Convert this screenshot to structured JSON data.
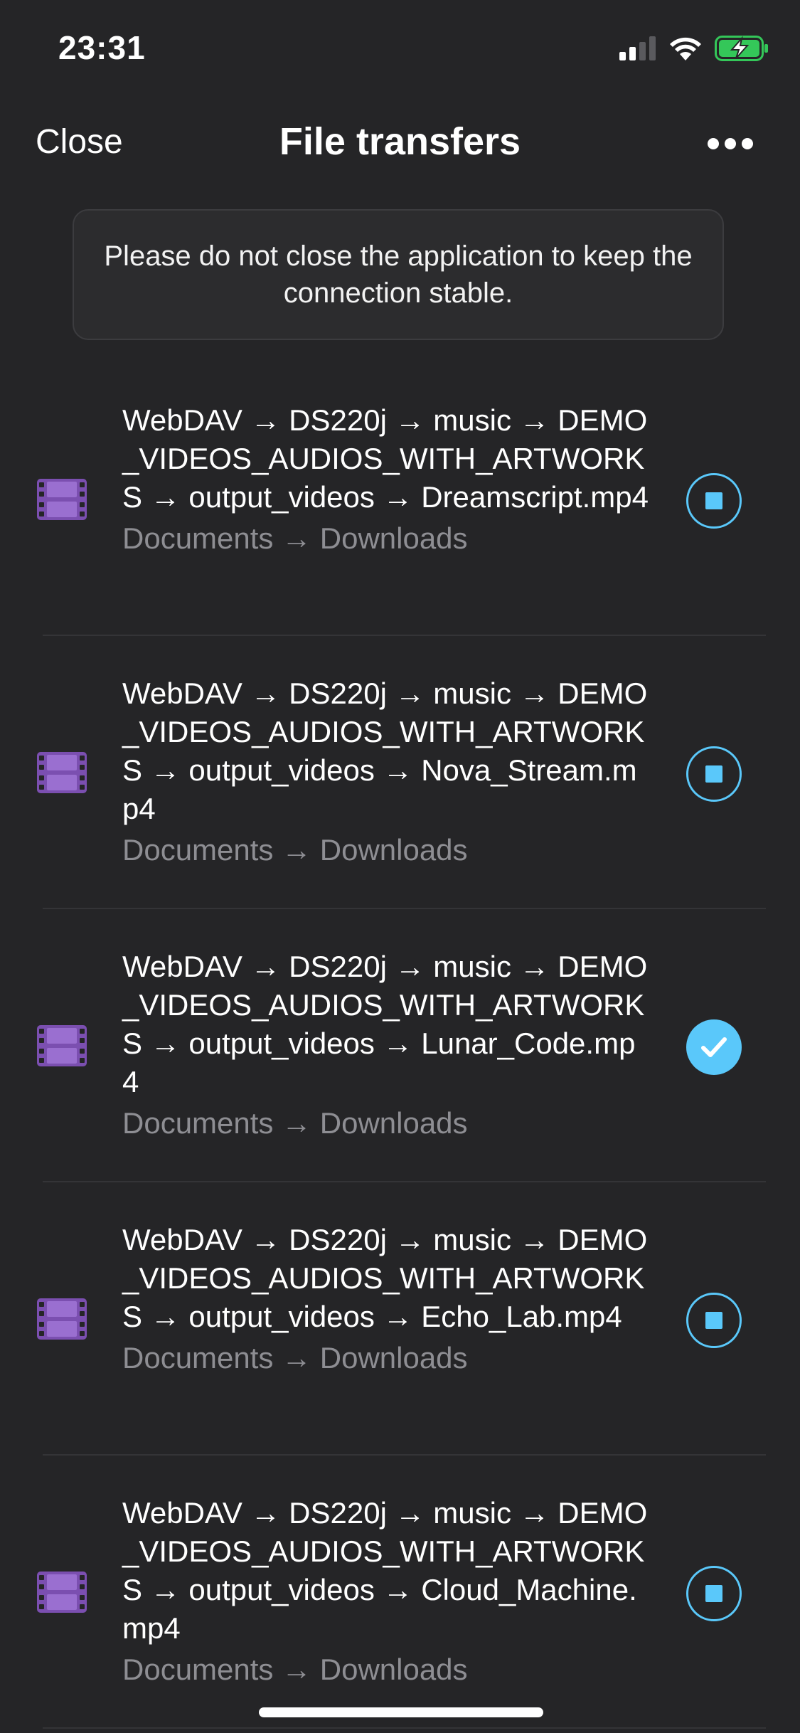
{
  "status_bar": {
    "time": "23:31"
  },
  "nav": {
    "close_label": "Close",
    "title": "File transfers",
    "more_icon": "ellipsis-icon"
  },
  "notice": {
    "text": "Please do not close the application to keep the connection stable."
  },
  "colors": {
    "background": "#252527",
    "accent": "#5ac8fa",
    "file_icon": "#7b4fb0",
    "secondary_text": "#8e8e93",
    "battery_fill": "#34c759"
  },
  "transfers": [
    {
      "path": "WebDAV → DS220j → music → DEMO_VIDEOS_AUDIOS_WITH_ARTWORKS → output_videos → Dreamscript.mp4",
      "destination": "Documents → Downloads",
      "state": "in-progress"
    },
    {
      "path": "WebDAV → DS220j → music → DEMO_VIDEOS_AUDIOS_WITH_ARTWORKS → output_videos → Nova_Stream.mp4",
      "destination": "Documents → Downloads",
      "state": "in-progress"
    },
    {
      "path": "WebDAV → DS220j → music → DEMO_VIDEOS_AUDIOS_WITH_ARTWORKS → output_videos → Lunar_Code.mp4",
      "destination": "Documents → Downloads",
      "state": "completed"
    },
    {
      "path": "WebDAV → DS220j → music → DEMO_VIDEOS_AUDIOS_WITH_ARTWORKS → output_videos → Echo_Lab.mp4",
      "destination": "Documents → Downloads",
      "state": "in-progress"
    },
    {
      "path": "WebDAV → DS220j → music → DEMO_VIDEOS_AUDIOS_WITH_ARTWORKS → output_videos → Cloud_Machine.mp4",
      "destination": "Documents → Downloads",
      "state": "in-progress"
    }
  ]
}
